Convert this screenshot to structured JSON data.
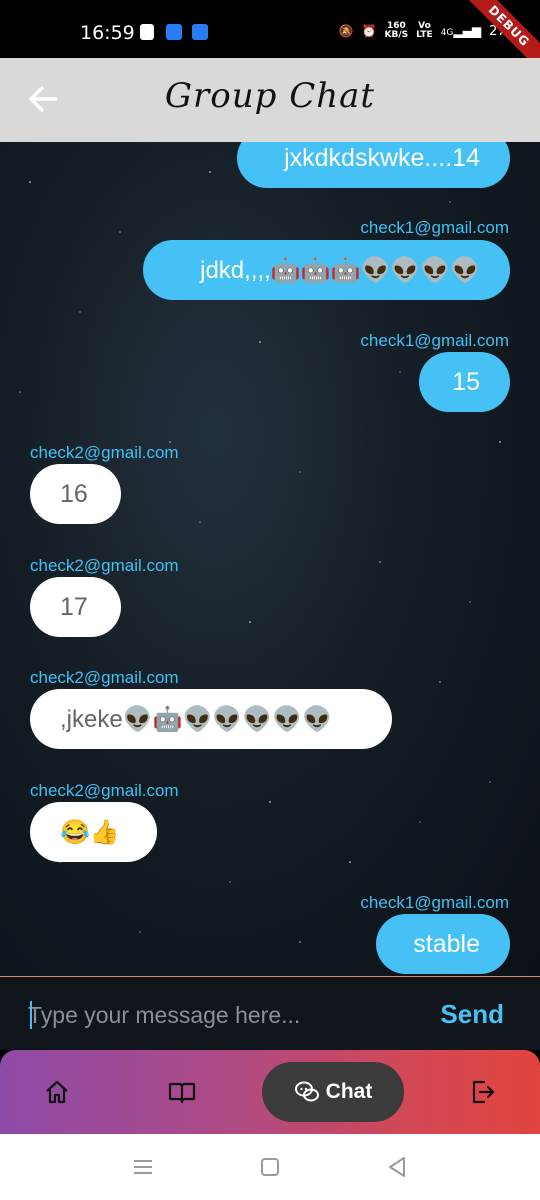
{
  "status_bar": {
    "time": "16:59",
    "speed_value": "160",
    "speed_unit": "KB/S",
    "network_top": "Vo",
    "network_bottom": "LTE",
    "signal": "4G",
    "battery": "27%",
    "debug_label": "DEBUG"
  },
  "app_bar": {
    "title": "Group Chat"
  },
  "messages": [
    {
      "sender": "",
      "text": "jxkdkdskwke....14",
      "outgoing": true
    },
    {
      "sender": "check1@gmail.com",
      "text": "jdkd,,,,🤖🤖🤖👽👽👽👽",
      "outgoing": true
    },
    {
      "sender": "check1@gmail.com",
      "text": "15",
      "outgoing": true
    },
    {
      "sender": "check2@gmail.com",
      "text": "16",
      "outgoing": false
    },
    {
      "sender": "check2@gmail.com",
      "text": "17",
      "outgoing": false
    },
    {
      "sender": "check2@gmail.com",
      "text": ",jkeke👽🤖👽👽👽👽👽",
      "outgoing": false
    },
    {
      "sender": "check2@gmail.com",
      "text": "😂👍",
      "outgoing": false
    },
    {
      "sender": "check1@gmail.com",
      "text": "stable",
      "outgoing": true
    }
  ],
  "composer": {
    "placeholder": "Type your message here...",
    "send_label": "Send"
  },
  "bottom_nav": {
    "items": [
      {
        "icon": "home-icon"
      },
      {
        "icon": "book-icon"
      },
      {
        "icon": "chat-icon",
        "label": "Chat",
        "active": true
      },
      {
        "icon": "logout-icon"
      }
    ]
  },
  "colors": {
    "accent": "#45c1f6",
    "sender_text": "#3ec1f3",
    "appbar_bg": "#d9d9d9",
    "nav_gradient_start": "#8e4aa8",
    "nav_gradient_end": "#e2443f"
  }
}
